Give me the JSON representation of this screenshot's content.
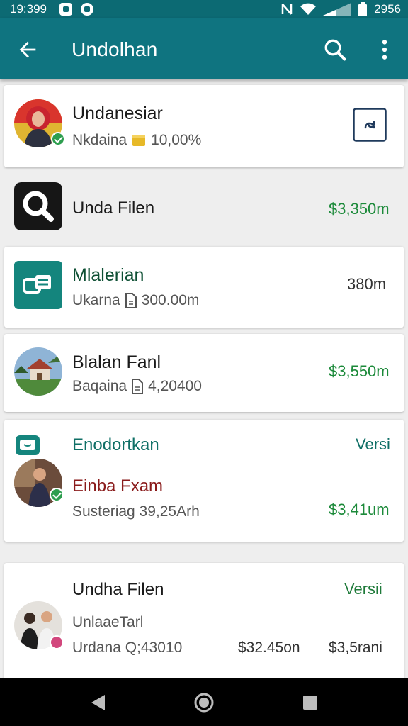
{
  "status_bar": {
    "time": "19:399",
    "battery_text": "2956",
    "icons": [
      "photo-notification-icon",
      "download-notification-icon",
      "nfc-icon",
      "wifi-icon",
      "signal-icon",
      "battery-icon"
    ]
  },
  "app_bar": {
    "title": "Undolhan",
    "icons": [
      "back-arrow-icon",
      "search-icon",
      "more-vert-icon"
    ]
  },
  "colors": {
    "app_bar": "#0f7480",
    "status_bar": "#0c6a73",
    "green_price": "#1c8a3a",
    "teal_title": "#0f6f66",
    "dark_red_text": "#8a1b1b"
  },
  "items": [
    {
      "title": "Undanesiar",
      "subtitle_name": "Nkdaina",
      "subtitle_value": "10,00%",
      "icons": [
        "user-avatar",
        "verified-badge-icon",
        "coin-icon",
        "refresh-icon"
      ]
    },
    {
      "title": "Unda Filen",
      "price": "$3,350m",
      "icons": [
        "magnifier-app-icon"
      ]
    },
    {
      "title": "Mlalerian",
      "subtitle_name": "Ukarna",
      "subtitle_value": "300.00m",
      "right_value": "380m",
      "icons": [
        "card-app-icon",
        "document-icon"
      ]
    },
    {
      "title": "Blalan Fanl",
      "subtitle_name": "Baqaina",
      "subtitle_value": "4,20400",
      "price": "$3,550m",
      "icons": [
        "house-photo",
        "document-icon"
      ]
    },
    {
      "header_title": "Enodortkan",
      "header_right": "Versi",
      "name": "Einba Fxam",
      "subtitle": "Susteriag 39,25Arh",
      "price": "$3,41um",
      "icons": [
        "chat-app-icon",
        "person-avatar",
        "verified-badge-icon"
      ]
    },
    {
      "title": "Undha Filen",
      "right_label": "Versii",
      "line2": "UnlaaeTarl",
      "line3_left": "Urdana Q;43010",
      "line3_mid": "$32.45on",
      "line3_right": "$3,5rani",
      "icons": [
        "group-avatar",
        "pink-badge-icon"
      ]
    }
  ],
  "nav": {
    "icons": [
      "back-triangle-icon",
      "home-circle-icon",
      "recents-square-icon"
    ]
  }
}
